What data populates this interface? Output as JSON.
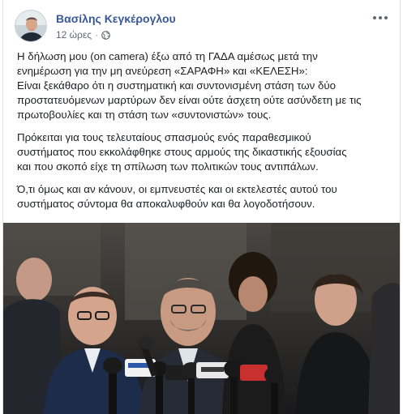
{
  "post": {
    "author": "Βασίλης Κεγκέρογλου",
    "time": "12 ώρες",
    "separator": "·",
    "privacy_icon": "globe-icon",
    "more_icon": "more-options-icon",
    "paragraphs": [
      {
        "lines": [
          "Η δήλωση μου (on camera) έξω από τη ΓΑΔΑ αμέσως μετά την",
          "ενημέρωση για την μη ανεύρεση «ΣΑΡΑΦΗ» και «ΚΕΛΕΣΗ»:",
          "Είναι ξεκάθαρο ότι η συστηματική και συντονισμένη στάση των δύο",
          "προστατευόμενων μαρτύρων δεν είναι ούτε άσχετη ούτε ασύνδετη με τις",
          "πρωτοβουλίες και τη στάση των «συντονιστών» τους."
        ]
      },
      {
        "lines": [
          "Πρόκειται για τους τελευταίους σπασμούς ενός παραθεσμικού",
          "συστήματος που εκκολάφθηκε στους αρμούς της δικαστικής εξουσίας",
          "και που σκοπό είχε τη σπίλωση των πολιτικών τους αντιπάλων."
        ]
      },
      {
        "lines": [
          "Ό,τι όμως και αν κάνουν, οι εμπνευστές και οι εκτελεστές αυτού του",
          "συστήματος σύντομα θα αποκαλυφθούν και θα λογοδοτήσουν."
        ]
      }
    ]
  },
  "colors": {
    "author": "#385898",
    "meta": "#606770",
    "text": "#1c1e21"
  }
}
